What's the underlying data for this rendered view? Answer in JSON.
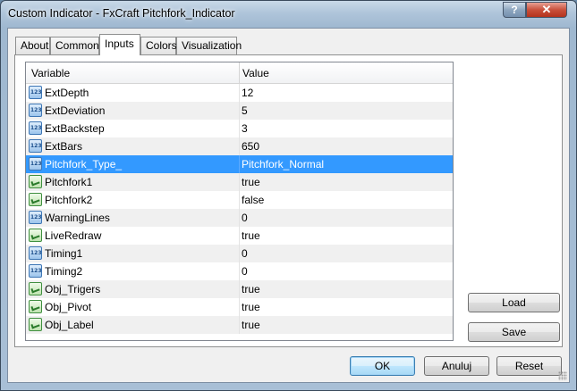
{
  "window": {
    "title": "Custom Indicator - FxCraft Pitchfork_Indicator",
    "help_glyph": "?",
    "close_glyph": "✕"
  },
  "tabs": [
    {
      "label": "About"
    },
    {
      "label": "Common"
    },
    {
      "label": "Inputs",
      "active": true
    },
    {
      "label": "Colors"
    },
    {
      "label": "Visualization"
    }
  ],
  "grid": {
    "columns": {
      "variable": "Variable",
      "value": "Value"
    },
    "rows": [
      {
        "icon": "numeric-icon",
        "variable": "ExtDepth",
        "value": "12"
      },
      {
        "icon": "numeric-icon",
        "variable": "ExtDeviation",
        "value": "5"
      },
      {
        "icon": "numeric-icon",
        "variable": "ExtBackstep",
        "value": "3"
      },
      {
        "icon": "numeric-icon",
        "variable": "ExtBars",
        "value": "650"
      },
      {
        "icon": "numeric-icon",
        "variable": "Pitchfork_Type_",
        "value": "Pitchfork_Normal",
        "selected": true
      },
      {
        "icon": "boolean-icon",
        "variable": "Pitchfork1",
        "value": "true"
      },
      {
        "icon": "boolean-icon",
        "variable": "Pitchfork2",
        "value": "false"
      },
      {
        "icon": "numeric-icon",
        "variable": "WarningLines",
        "value": "0"
      },
      {
        "icon": "boolean-icon",
        "variable": "LiveRedraw",
        "value": "true"
      },
      {
        "icon": "numeric-icon",
        "variable": "Timing1",
        "value": "0"
      },
      {
        "icon": "numeric-icon",
        "variable": "Timing2",
        "value": "0"
      },
      {
        "icon": "boolean-icon",
        "variable": "Obj_Trigers",
        "value": "true"
      },
      {
        "icon": "boolean-icon",
        "variable": "Obj_Pivot",
        "value": "true"
      },
      {
        "icon": "boolean-icon",
        "variable": "Obj_Label",
        "value": "true"
      }
    ]
  },
  "side_buttons": {
    "load": "Load",
    "save": "Save"
  },
  "footer_buttons": {
    "ok": "OK",
    "cancel": "Anuluj",
    "reset": "Reset"
  },
  "colors": {
    "selection": "#3399ff",
    "alt_row": "#f0f0f0"
  }
}
